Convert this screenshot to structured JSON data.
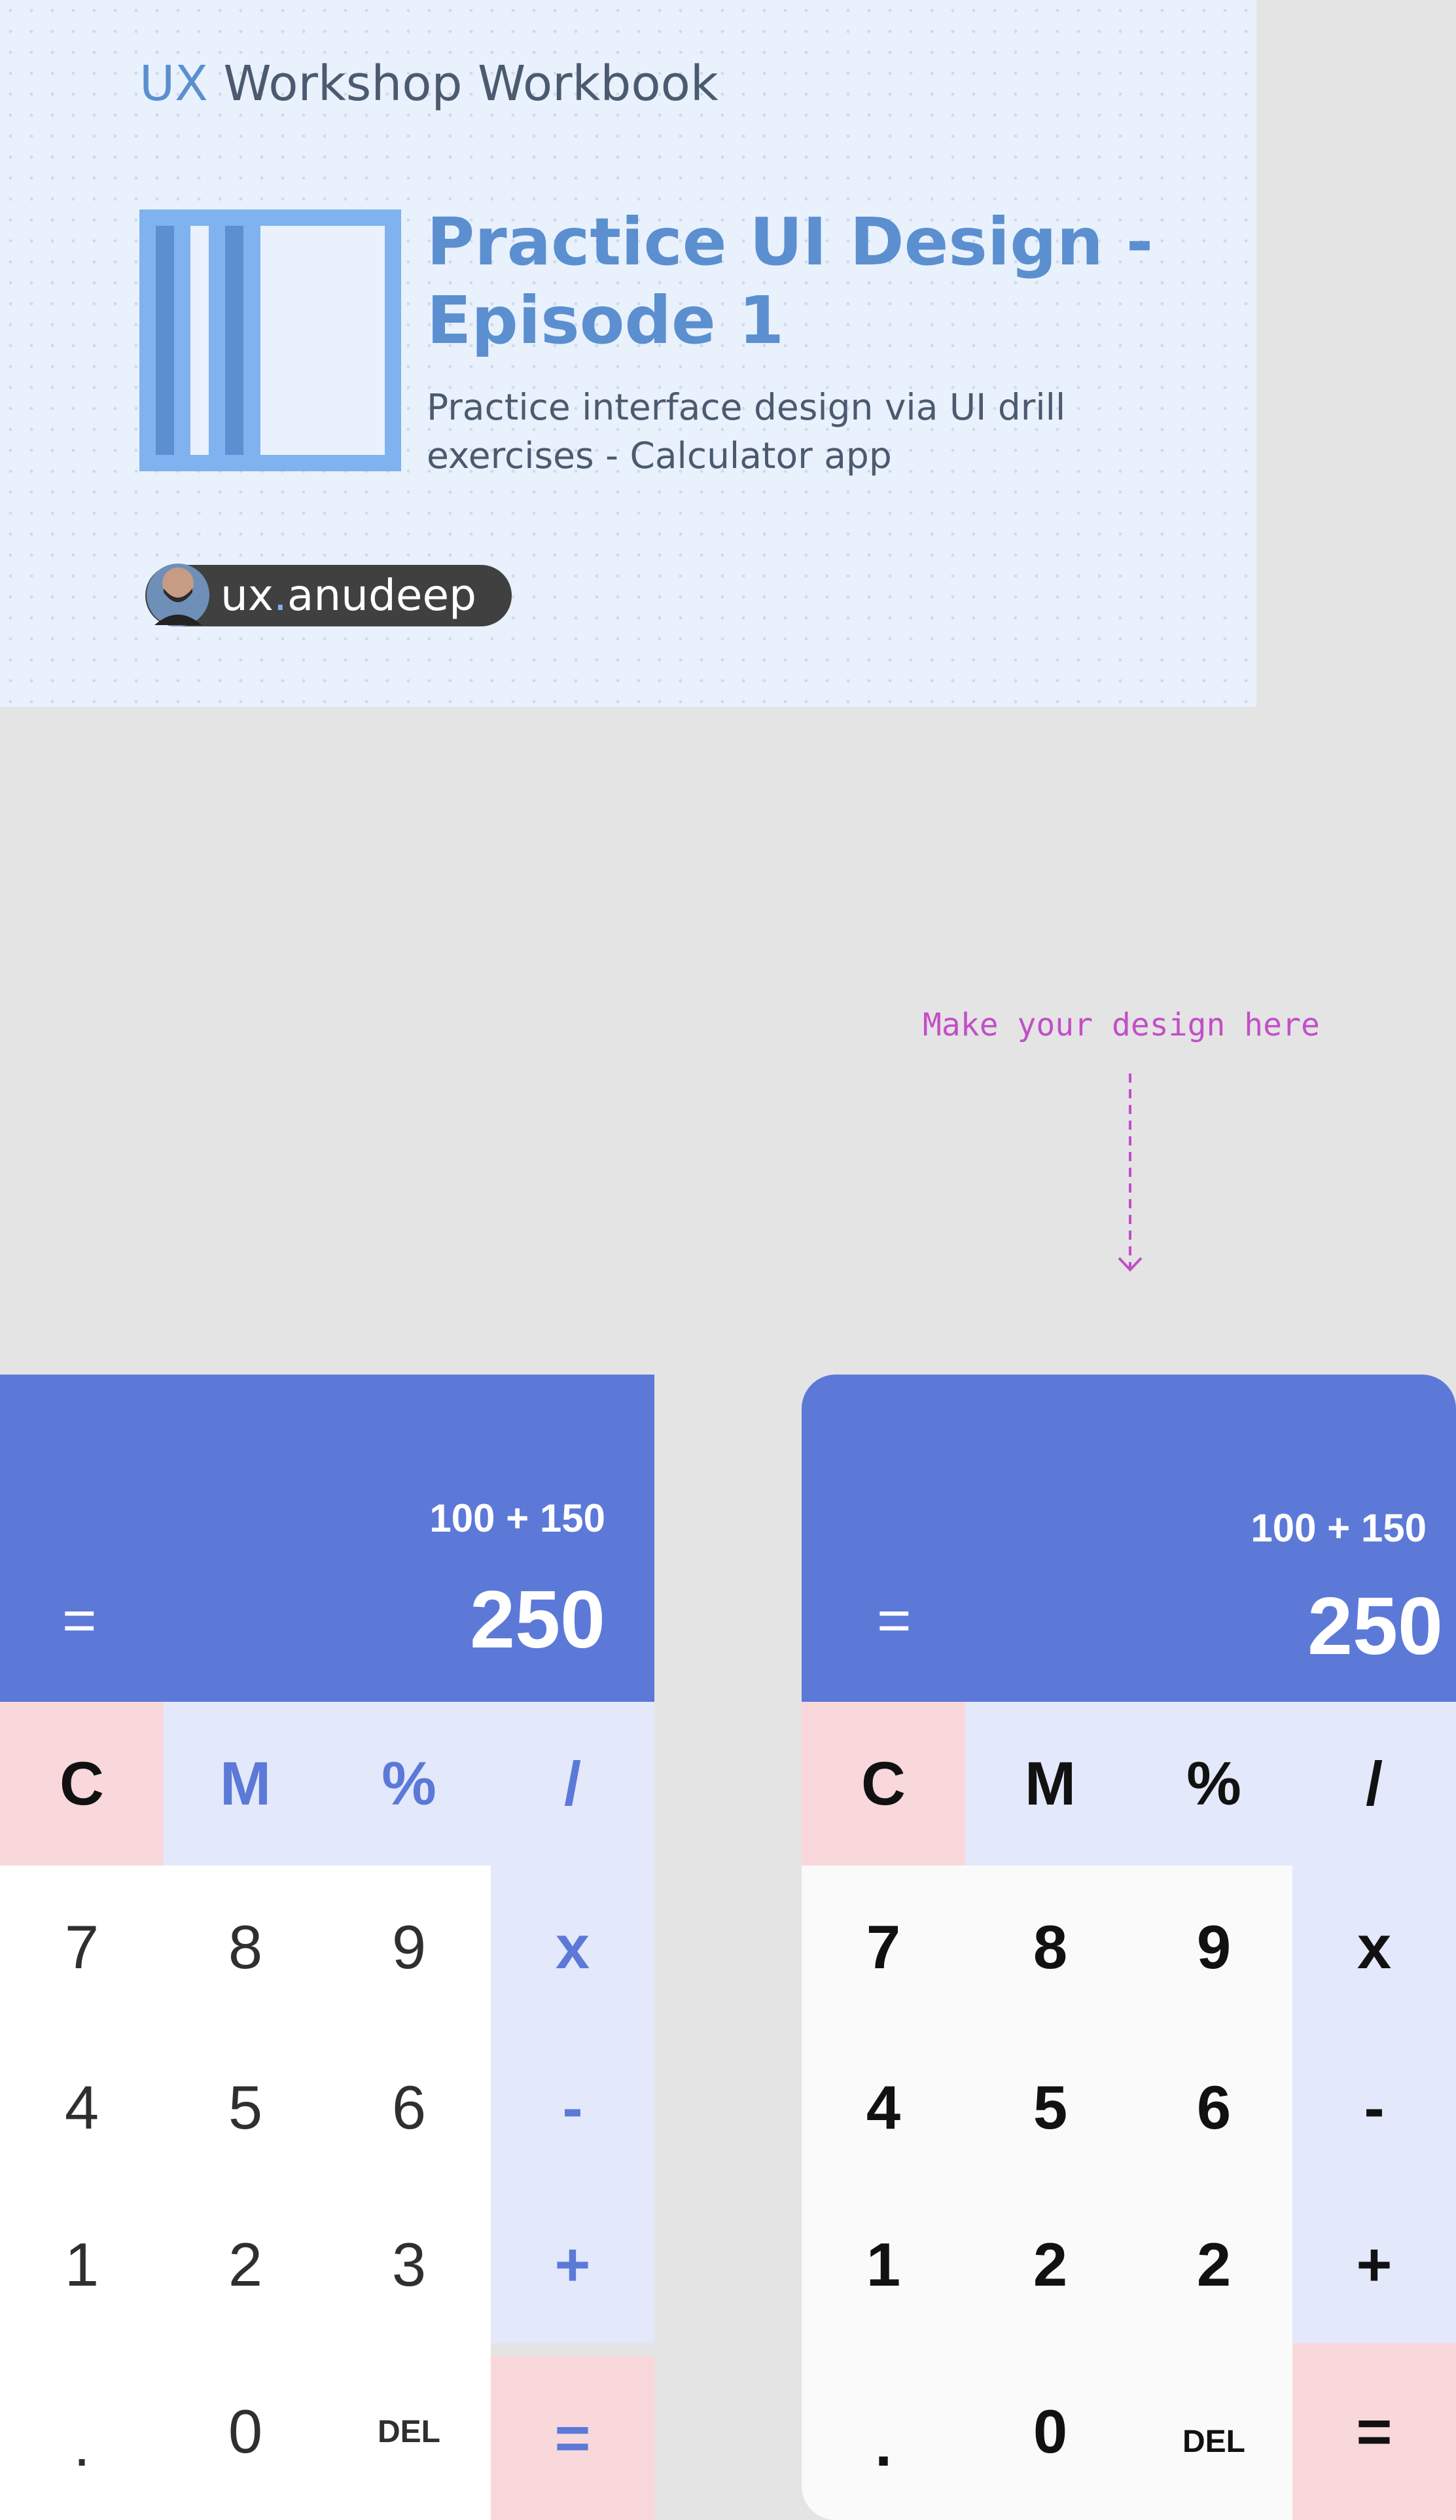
{
  "header": {
    "brand_prefix": "UX",
    "brand_rest": " Workshop Workbook",
    "episode_title": "Practice UI Design - Episode 1",
    "subtitle": "Practice interface design via UI drill exercises - Calculator app"
  },
  "author": {
    "handle_prefix": "ux",
    "handle_dot": ".",
    "handle_suffix": "anudeep"
  },
  "annotation": {
    "text": "Make your design here"
  },
  "colors": {
    "accent": "#5c79d8",
    "clear_bg": "#f8d8db",
    "op_bg": "#e3e8fb",
    "annotation": "#c24fc8",
    "brand": "#5b8fd0"
  },
  "calculator_reference": {
    "expression": "100 + 150",
    "equals": "=",
    "result": "250",
    "keys": {
      "clear": "C",
      "memory": "M",
      "percent": "%",
      "divide": "/",
      "seven": "7",
      "eight": "8",
      "nine": "9",
      "multiply": "x",
      "four": "4",
      "five": "5",
      "six": "6",
      "minus": "-",
      "one": "1",
      "two": "2",
      "three": "3",
      "plus": "+",
      "decimal": ".",
      "zero": "0",
      "delete": "DEL",
      "equals": "="
    }
  },
  "calculator_design": {
    "expression": "100 + 150",
    "equals": "=",
    "result": "250",
    "keys": {
      "clear": "C",
      "memory": "M",
      "percent": "%",
      "divide": "/",
      "seven": "7",
      "eight": "8",
      "nine": "9",
      "multiply": "x",
      "four": "4",
      "five": "5",
      "six": "6",
      "minus": "-",
      "one": "1",
      "two": "2",
      "three": "2",
      "plus": "+",
      "decimal": ".",
      "zero": "0",
      "delete": "DEL",
      "equals": "="
    }
  }
}
